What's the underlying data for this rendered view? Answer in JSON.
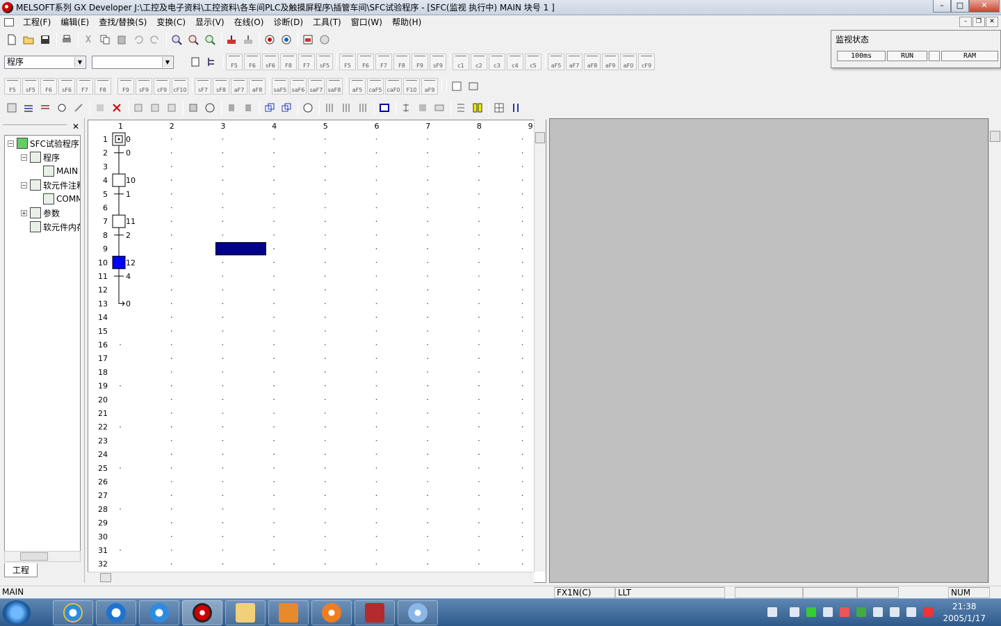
{
  "window": {
    "title": "MELSOFT系列 GX Developer J:\\工控及电子资料\\工控资料\\各车间PLC及触摸屏程序\\插管车间\\SFC试验程序 - [SFC(监视 执行中)    MAIN     块号   1    ]",
    "min": "–",
    "max": "□",
    "close": "✕"
  },
  "menu": [
    "工程(F)",
    "编辑(E)",
    "查找/替换(S)",
    "变换(C)",
    "显示(V)",
    "在线(O)",
    "诊断(D)",
    "工具(T)",
    "窗口(W)",
    "帮助(H)"
  ],
  "toolbar2": {
    "combo1": "程序",
    "combo2": "",
    "sfc_keys": [
      "F5",
      "F6",
      "sF6",
      "F8",
      "F7",
      "sF5",
      "F5",
      "F6",
      "F7",
      "F8",
      "F9",
      "sF9",
      "c1",
      "c2",
      "c3",
      "c4",
      "c5",
      "aF5",
      "aF7",
      "aF8",
      "aF9",
      "aF0",
      "cF9"
    ]
  },
  "toolbar3": {
    "ladder_keys": [
      "F5",
      "sF5",
      "F6",
      "sF6",
      "F7",
      "F8",
      "F9",
      "sF9",
      "cF9",
      "cF10",
      "sF7",
      "sF8",
      "aF7",
      "aF8",
      "saF5",
      "saF6",
      "saF7",
      "saF8",
      "aF5",
      "caF5",
      "caF0",
      "F10",
      "aF9"
    ]
  },
  "monitor": {
    "title": "监视状态",
    "scan": "100ms",
    "mode": "RUN",
    "blank": "",
    "memory": "RAM"
  },
  "tree": {
    "close": "✕",
    "tab": "工程",
    "nodes": [
      {
        "label": "SFC试验程序",
        "level": 0,
        "exp": "−"
      },
      {
        "label": "程序",
        "level": 1,
        "exp": "−"
      },
      {
        "label": "MAIN",
        "level": 2,
        "exp": ""
      },
      {
        "label": "软元件注释",
        "level": 1,
        "exp": "−"
      },
      {
        "label": "COMMENT",
        "level": 2,
        "exp": ""
      },
      {
        "label": "参数",
        "level": 1,
        "exp": "+"
      },
      {
        "label": "软元件内存",
        "level": 1,
        "exp": ""
      }
    ]
  },
  "sfc": {
    "columns": [
      "1",
      "2",
      "3",
      "4",
      "5",
      "6",
      "7",
      "8",
      "9"
    ],
    "rows": [
      "1",
      "2",
      "3",
      "4",
      "5",
      "6",
      "7",
      "8",
      "9",
      "10",
      "11",
      "12",
      "13",
      "14",
      "15",
      "16",
      "17",
      "18",
      "19",
      "20",
      "21",
      "22",
      "23",
      "24",
      "25",
      "26",
      "27",
      "28",
      "29",
      "30",
      "31",
      "32"
    ],
    "steps": [
      {
        "row": 1,
        "label": "0",
        "type": "initial"
      },
      {
        "row": 4,
        "label": "10",
        "type": "normal"
      },
      {
        "row": 7,
        "label": "11",
        "type": "normal"
      },
      {
        "row": 10,
        "label": "12",
        "type": "active"
      }
    ],
    "transitions": [
      {
        "row": 2,
        "label": "0"
      },
      {
        "row": 5,
        "label": "1"
      },
      {
        "row": 8,
        "label": "2"
      },
      {
        "row": 11,
        "label": "4"
      }
    ],
    "jump": {
      "row": 13,
      "label": "0"
    },
    "cursor": {
      "row": 9,
      "col": 3
    }
  },
  "status": {
    "program": "MAIN",
    "plc": "FX1N(C)",
    "lang": "LLT",
    "num": "NUM"
  },
  "taskbar": {
    "clock_time": "21:38",
    "clock_date": "2005/1/17"
  },
  "colors": {
    "active_step": "#0000ff",
    "cursor": "#00008b",
    "gray_area": "#c0c0c0"
  }
}
